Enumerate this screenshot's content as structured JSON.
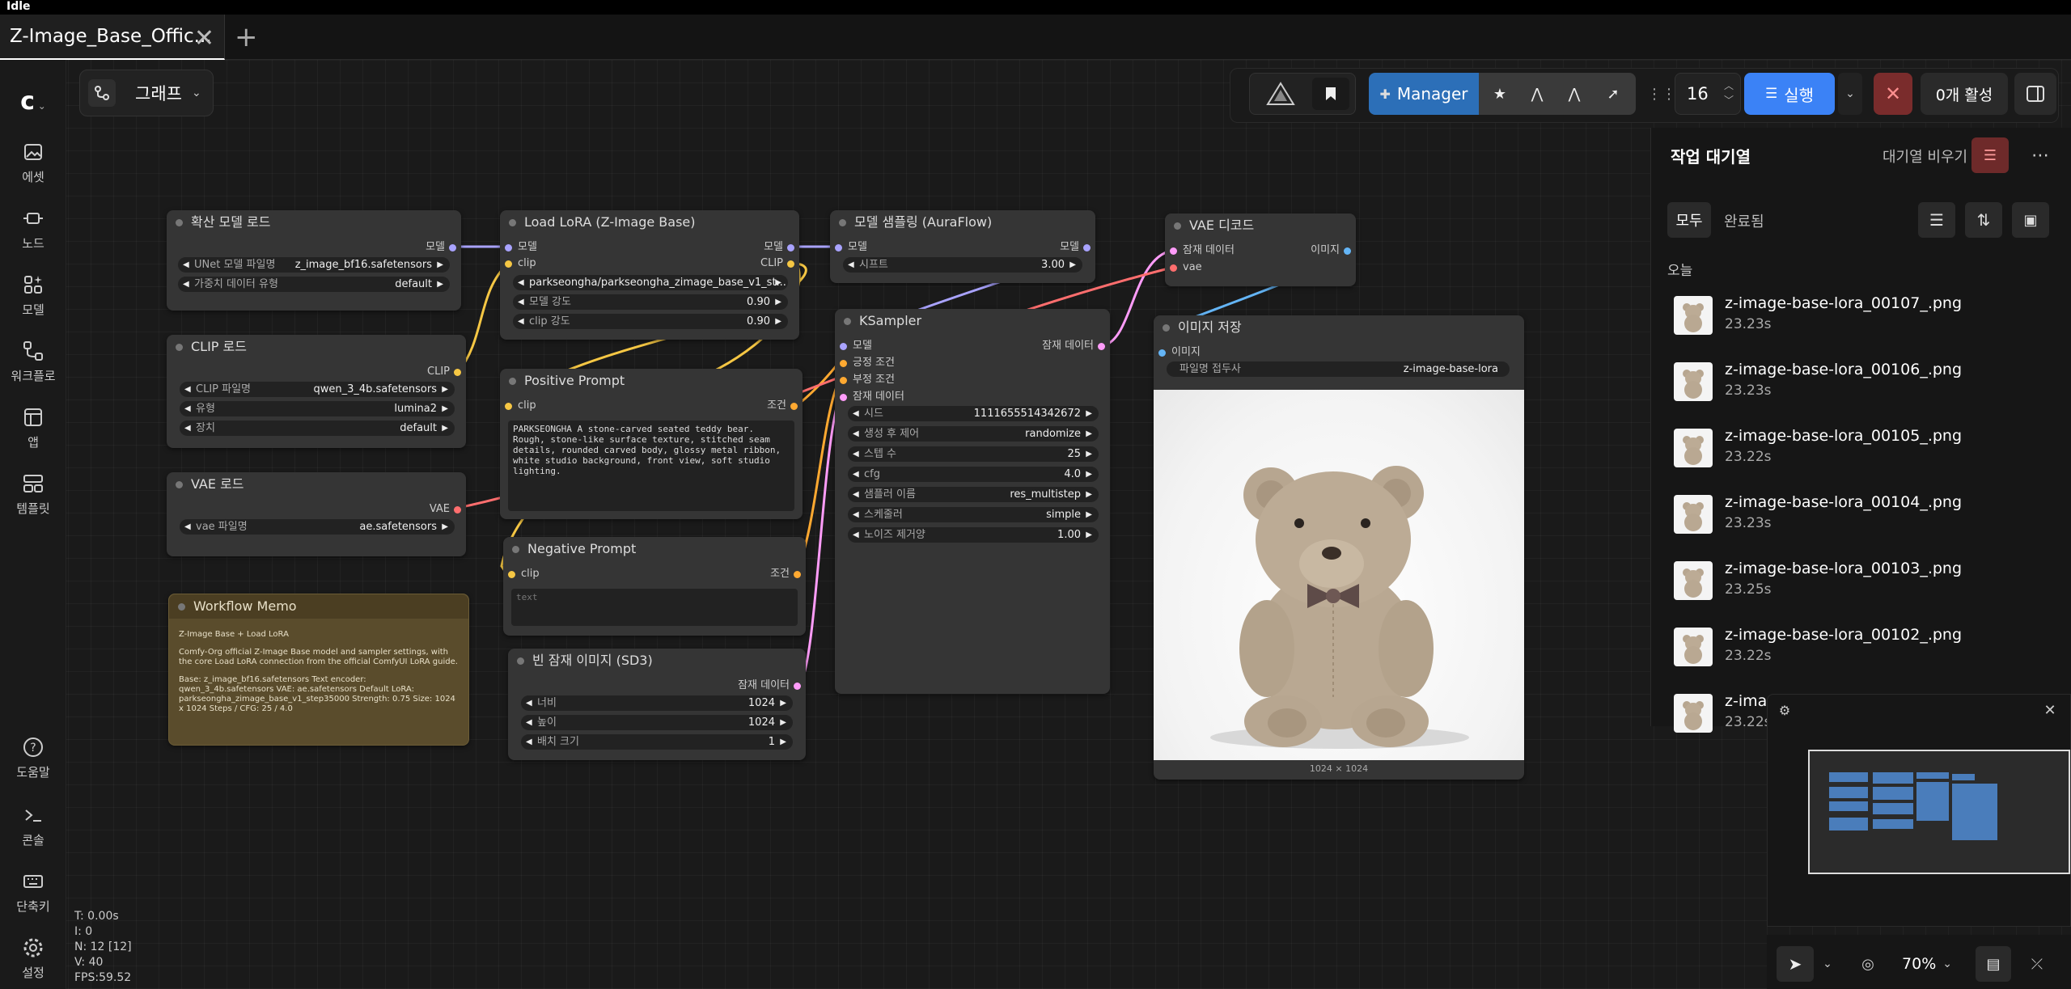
{
  "status": "Idle",
  "tab": {
    "title": "Z-Image_Base_Offic..."
  },
  "graph_menu": {
    "label": "그래프"
  },
  "sidebar": {
    "items": [
      {
        "label": "에셋"
      },
      {
        "label": "노드"
      },
      {
        "label": "모델"
      },
      {
        "label": "워크플로"
      },
      {
        "label": "앱"
      },
      {
        "label": "템플릿"
      }
    ],
    "bottom": [
      {
        "label": "도움말"
      },
      {
        "label": "콘솔"
      },
      {
        "label": "단축키"
      },
      {
        "label": "설정"
      }
    ]
  },
  "toolbar": {
    "manager_label": "Manager",
    "batch_count": "16",
    "run_label": "실행",
    "active_label": "0개 활성"
  },
  "queue": {
    "title": "작업 대기열",
    "clear_label": "대기열 비우기",
    "tab_all": "모두",
    "tab_done": "완료됨",
    "group_today": "오늘",
    "items": [
      {
        "name": "z-image-base-lora_00107_.png",
        "time": "23.23s"
      },
      {
        "name": "z-image-base-lora_00106_.png",
        "time": "23.23s"
      },
      {
        "name": "z-image-base-lora_00105_.png",
        "time": "23.22s"
      },
      {
        "name": "z-image-base-lora_00104_.png",
        "time": "23.23s"
      },
      {
        "name": "z-image-base-lora_00103_.png",
        "time": "23.25s"
      },
      {
        "name": "z-image-base-lora_00102_.png",
        "time": "23.22s"
      },
      {
        "name": "z-imag",
        "time": "23.22s"
      }
    ]
  },
  "stats": {
    "t": "T: 0.00s",
    "i": "I: 0",
    "n": "N: 12 [12]",
    "v": "V: 40",
    "fps": "FPS:59.52"
  },
  "zoom": "70%",
  "nodes": {
    "diffusion": {
      "title": "확산 모델 로드",
      "out": "모델",
      "w1_label": "UNet 모델 파일명",
      "w1_value": "z_image_bf16.safetensors",
      "w2_label": "가중치 데이터 유형",
      "w2_value": "default"
    },
    "clip": {
      "title": "CLIP 로드",
      "out": "CLIP",
      "w1_label": "CLIP 파일명",
      "w1_value": "qwen_3_4b.safetensors",
      "w2_label": "유형",
      "w2_value": "lumina2",
      "w3_label": "장치",
      "w3_value": "default"
    },
    "vae": {
      "title": "VAE 로드",
      "out": "VAE",
      "w1_label": "vae 파일명",
      "w1_value": "ae.safetensors"
    },
    "memo": {
      "title": "Workflow Memo",
      "line1": "Z-Image Base + Load LoRA",
      "line2": "Comfy-Org official Z-Image Base model and sampler settings, with the core Load LoRA connection from the official ComfyUI LoRA guide.",
      "line3": "Base: z_image_bf16.safetensors Text encoder: qwen_3_4b.safetensors VAE: ae.safetensors Default LoRA: parkseongha_zimage_base_v1_step35000 Strength: 0.75 Size: 1024 x 1024 Steps / CFG: 25 / 4.0"
    },
    "lora": {
      "title": "Load LoRA (Z-Image Base)",
      "in1": "모델",
      "in2": "clip",
      "out1": "모델",
      "out2": "CLIP",
      "w1_value": "parkseongha/parkseongha_zimage_base_v1_st...",
      "w2_label": "모델 강도",
      "w2_value": "0.90",
      "w3_label": "clip 강도",
      "w3_value": "0.90"
    },
    "pos": {
      "title": "Positive Prompt",
      "in": "clip",
      "out": "조건",
      "text": "PARKSEONGHA A stone-carved seated teddy bear. Rough, stone-like surface texture, stitched seam details, rounded carved body, glossy metal ribbon, white studio background, front view, soft studio lighting."
    },
    "neg": {
      "title": "Negative Prompt",
      "in": "clip",
      "out": "조건",
      "placeholder": "text"
    },
    "latent": {
      "title": "빈 잠재 이미지 (SD3)",
      "out": "잠재 데이터",
      "w1_label": "너비",
      "w1_value": "1024",
      "w2_label": "높이",
      "w2_value": "1024",
      "w3_label": "배치 크기",
      "w3_value": "1"
    },
    "aura": {
      "title": "모델 샘플링 (AuraFlow)",
      "in": "모델",
      "out": "모델",
      "w1_label": "시프트",
      "w1_value": "3.00"
    },
    "ks": {
      "title": "KSampler",
      "in1": "모델",
      "in2": "긍정 조건",
      "in3": "부정 조건",
      "in4": "잠재 데이터",
      "out": "잠재 데이터",
      "w": [
        {
          "label": "시드",
          "value": "1111655514342672"
        },
        {
          "label": "생성 후 제어",
          "value": "randomize"
        },
        {
          "label": "스텝 수",
          "value": "25"
        },
        {
          "label": "cfg",
          "value": "4.0"
        },
        {
          "label": "샘플러 이름",
          "value": "res_multistep"
        },
        {
          "label": "스케줄러",
          "value": "simple"
        },
        {
          "label": "노이즈 제거양",
          "value": "1.00"
        }
      ]
    },
    "vaed": {
      "title": "VAE 디코드",
      "in1": "잠재 데이터",
      "in2": "vae",
      "out": "이미지"
    },
    "save": {
      "title": "이미지 저장",
      "in": "이미지",
      "w1_label": "파일명 접두사",
      "w1_value": "z-image-base-lora",
      "size": "1024 × 1024"
    }
  }
}
